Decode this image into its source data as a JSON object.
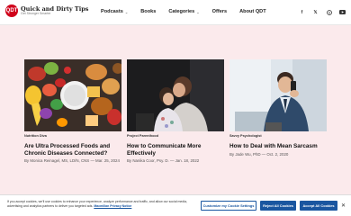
{
  "header": {
    "logo_mark": "QDT",
    "logo_title": "Quick and Dirty Tips",
    "logo_subtitle": "Get Stronger Smarter",
    "nav": [
      {
        "label": "Podcasts",
        "has_dropdown": true
      },
      {
        "label": "Books",
        "has_dropdown": false
      },
      {
        "label": "Categories",
        "has_dropdown": true
      },
      {
        "label": "Offers",
        "has_dropdown": false
      },
      {
        "label": "About QDT",
        "has_dropdown": false
      }
    ],
    "socials": [
      "facebook-icon",
      "x-icon",
      "pinterest-icon",
      "youtube-icon"
    ]
  },
  "articles": [
    {
      "image": "processed-foods-photo",
      "category": "Nutrition Diva",
      "title": "Are Ultra Processed Foods and Chronic Diseases Connected?",
      "meta": "By Monica Reinagel, MS, LD/N, CNS — Mar. 25, 2024"
    },
    {
      "image": "parent-child-photo",
      "category": "Project Parenthood",
      "title": "How to Communicate More Effectively",
      "meta": "By Nanika Coor, Psy. D. — Jan. 18, 2022"
    },
    {
      "image": "man-with-phone-photo",
      "category": "Savvy Psychologist",
      "title": "How to Deal with Mean Sarcasm",
      "meta": "By Jade Wu, PhD — Oct. 2, 2020"
    }
  ],
  "cookie": {
    "text": "If you accept cookies, we'll use cookies to enhance your experience, analyze performance and traffic, and allow our social media, advertising and analytics partners to deliver you targeted ads.",
    "link": "Macmillan Privacy Notice",
    "customize_label": "Customize my Cookie Settings",
    "reject_label": "Reject All Cookies",
    "accept_label": "Accept All Cookies",
    "close_glyph": "✕"
  },
  "colors": {
    "brand": "#d0021b",
    "band": "#fbeaec",
    "button": "#1a56a0"
  }
}
